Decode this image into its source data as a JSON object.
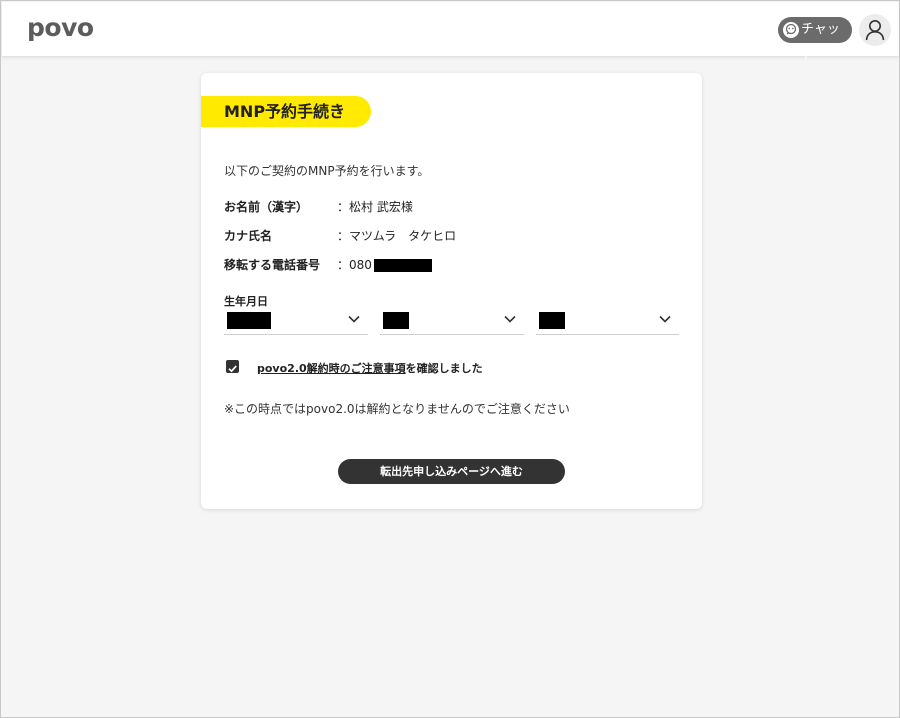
{
  "header": {
    "logo_text": "povo",
    "chat_label": "チャット"
  },
  "card": {
    "title": "MNP予約手続き",
    "intro": "以下のご契約のMNP予約を行います。",
    "rows": [
      {
        "label": "お名前（漢字）",
        "value": "：松村 武宏様"
      },
      {
        "label": "カナ氏名",
        "value": "：マツムラ　タケヒロ"
      },
      {
        "label": "移転する電話番号",
        "value": "：080"
      }
    ],
    "dob_label": "生年月日",
    "agreement_link": "povo2.0解約時のご注意事項",
    "agreement_suffix": "を確認しました",
    "agreement_checked": true,
    "notice": "※この時点ではpovo2.0は解約となりませんのでご注意ください",
    "submit_label": "転出先申し込みページへ進む"
  },
  "colors": {
    "accent": "#ffea00",
    "dark": "#333333",
    "chat_bg": "#6b6b6b"
  },
  "icons": [
    "chat-icon",
    "user-icon",
    "chevron-down-icon",
    "check-icon"
  ]
}
